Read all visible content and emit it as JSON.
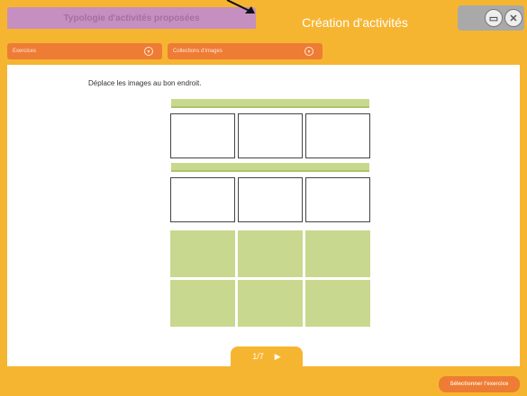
{
  "header": {
    "tab_typologie": "Typologie d'activités proposées",
    "tab_creation": "Création d'activités"
  },
  "toolbar": {
    "dropdown_exercises": "Exercices",
    "dropdown_collections": "Collections d'images"
  },
  "main": {
    "instruction": "Déplace les images au bon endroit."
  },
  "footer": {
    "pager": "1/7",
    "select_button": "Sélectionner l'exercice"
  },
  "colors": {
    "frame": "#f6b531",
    "tab_active": "#c58fc0",
    "dropdown": "#ee7c35",
    "tile": "#c8d88e"
  }
}
